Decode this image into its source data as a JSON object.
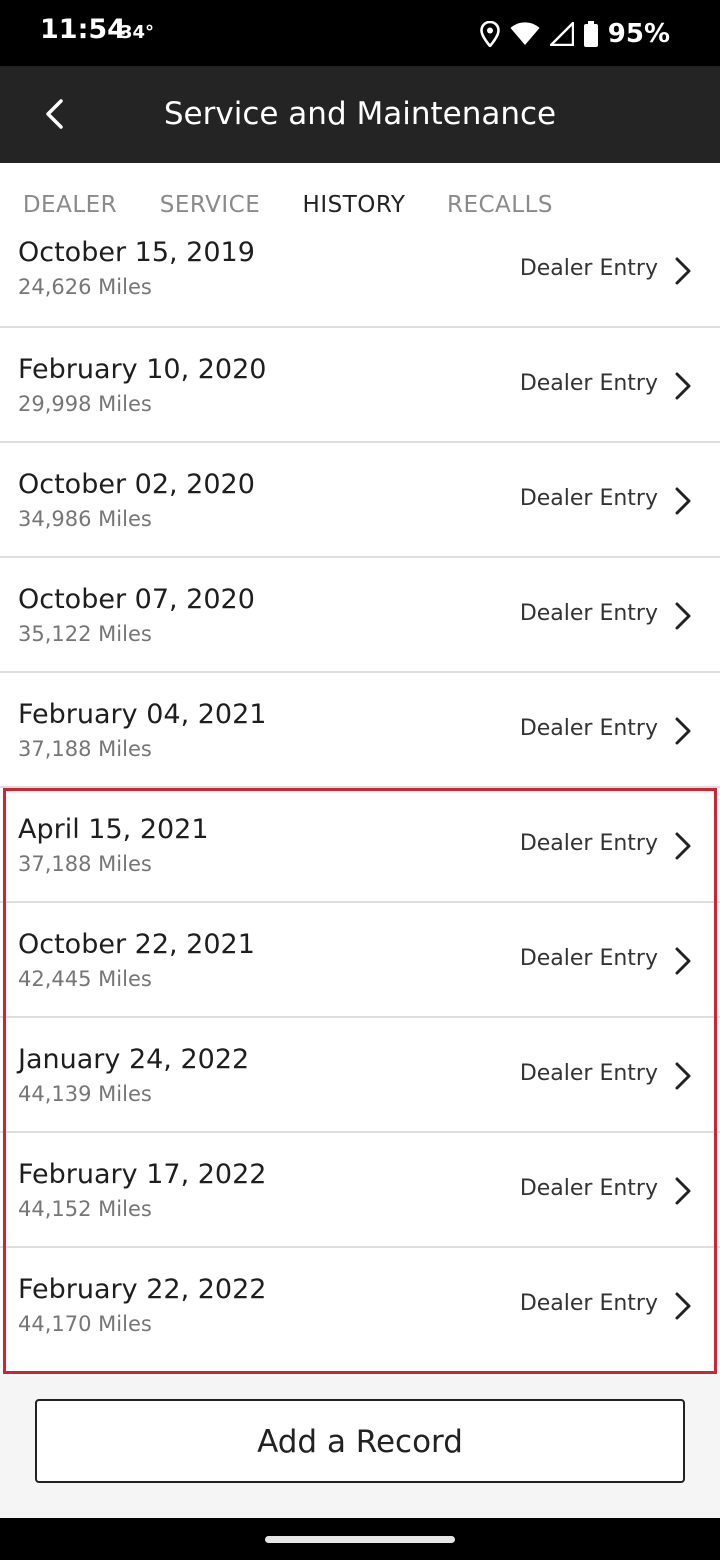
{
  "status_bar": {
    "time": "11:54",
    "temperature": "34°",
    "battery": "95%",
    "icons": [
      "location-icon",
      "wifi-icon",
      "signal-icon",
      "battery-icon"
    ]
  },
  "app_bar": {
    "title": "Service and Maintenance",
    "back_icon": "back-arrow-icon"
  },
  "tabs": [
    {
      "label": "DEALER",
      "active": false
    },
    {
      "label": "SERVICE",
      "active": false
    },
    {
      "label": "HISTORY",
      "active": true
    },
    {
      "label": "RECALLS",
      "active": false
    }
  ],
  "records": [
    {
      "date": "October 15, 2019",
      "miles": "24,626 Miles",
      "entry": "Dealer Entry"
    },
    {
      "date": "February 10, 2020",
      "miles": "29,998 Miles",
      "entry": "Dealer Entry"
    },
    {
      "date": "October 02, 2020",
      "miles": "34,986 Miles",
      "entry": "Dealer Entry"
    },
    {
      "date": "October 07, 2020",
      "miles": "35,122 Miles",
      "entry": "Dealer Entry"
    },
    {
      "date": "February 04, 2021",
      "miles": "37,188 Miles",
      "entry": "Dealer Entry"
    },
    {
      "date": "April 15, 2021",
      "miles": "37,188 Miles",
      "entry": "Dealer Entry"
    },
    {
      "date": "October 22, 2021",
      "miles": "42,445 Miles",
      "entry": "Dealer Entry"
    },
    {
      "date": "January 24, 2022",
      "miles": "44,139 Miles",
      "entry": "Dealer Entry"
    },
    {
      "date": "February 17, 2022",
      "miles": "44,152 Miles",
      "entry": "Dealer Entry"
    },
    {
      "date": "February 22, 2022",
      "miles": "44,170 Miles",
      "entry": "Dealer Entry"
    }
  ],
  "add_record_label": "Add a Record",
  "colors": {
    "app_bar": "#242424",
    "highlight": "#d32233",
    "active_tab": "#222222",
    "inactive_tab": "#8a8a8a"
  }
}
